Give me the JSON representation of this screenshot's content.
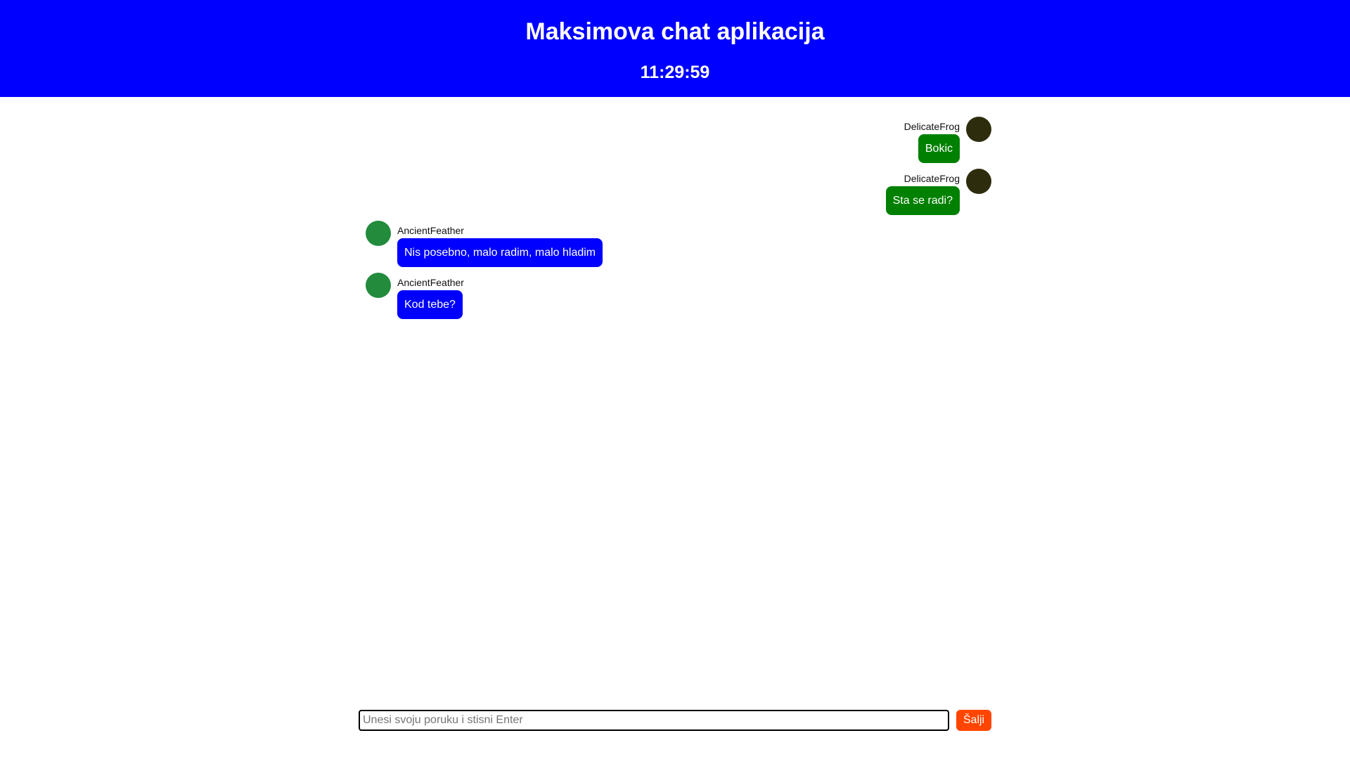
{
  "header": {
    "title": "Maksimova chat aplikacija",
    "clock": "11:29:59",
    "background_color": "#0000ff"
  },
  "messages": [
    {
      "direction": "outgoing",
      "username": "DelicateFrog",
      "text": "Bokic",
      "avatar_color": "#2d2d0d",
      "bubble_color": "#008000"
    },
    {
      "direction": "outgoing",
      "username": "DelicateFrog",
      "text": "Sta se radi?",
      "avatar_color": "#2d2d0d",
      "bubble_color": "#008000"
    },
    {
      "direction": "incoming",
      "username": "AncientFeather",
      "text": "Nis posebno, malo radim, malo hladim",
      "avatar_color": "#228b3c",
      "bubble_color": "#0000ff"
    },
    {
      "direction": "incoming",
      "username": "AncientFeather",
      "text": "Kod tebe?",
      "avatar_color": "#228b3c",
      "bubble_color": "#0000ff"
    }
  ],
  "composer": {
    "placeholder": "Unesi svoju poruku i stisni Enter",
    "value": "",
    "send_label": "Šalji",
    "send_color": "#ff4500"
  }
}
